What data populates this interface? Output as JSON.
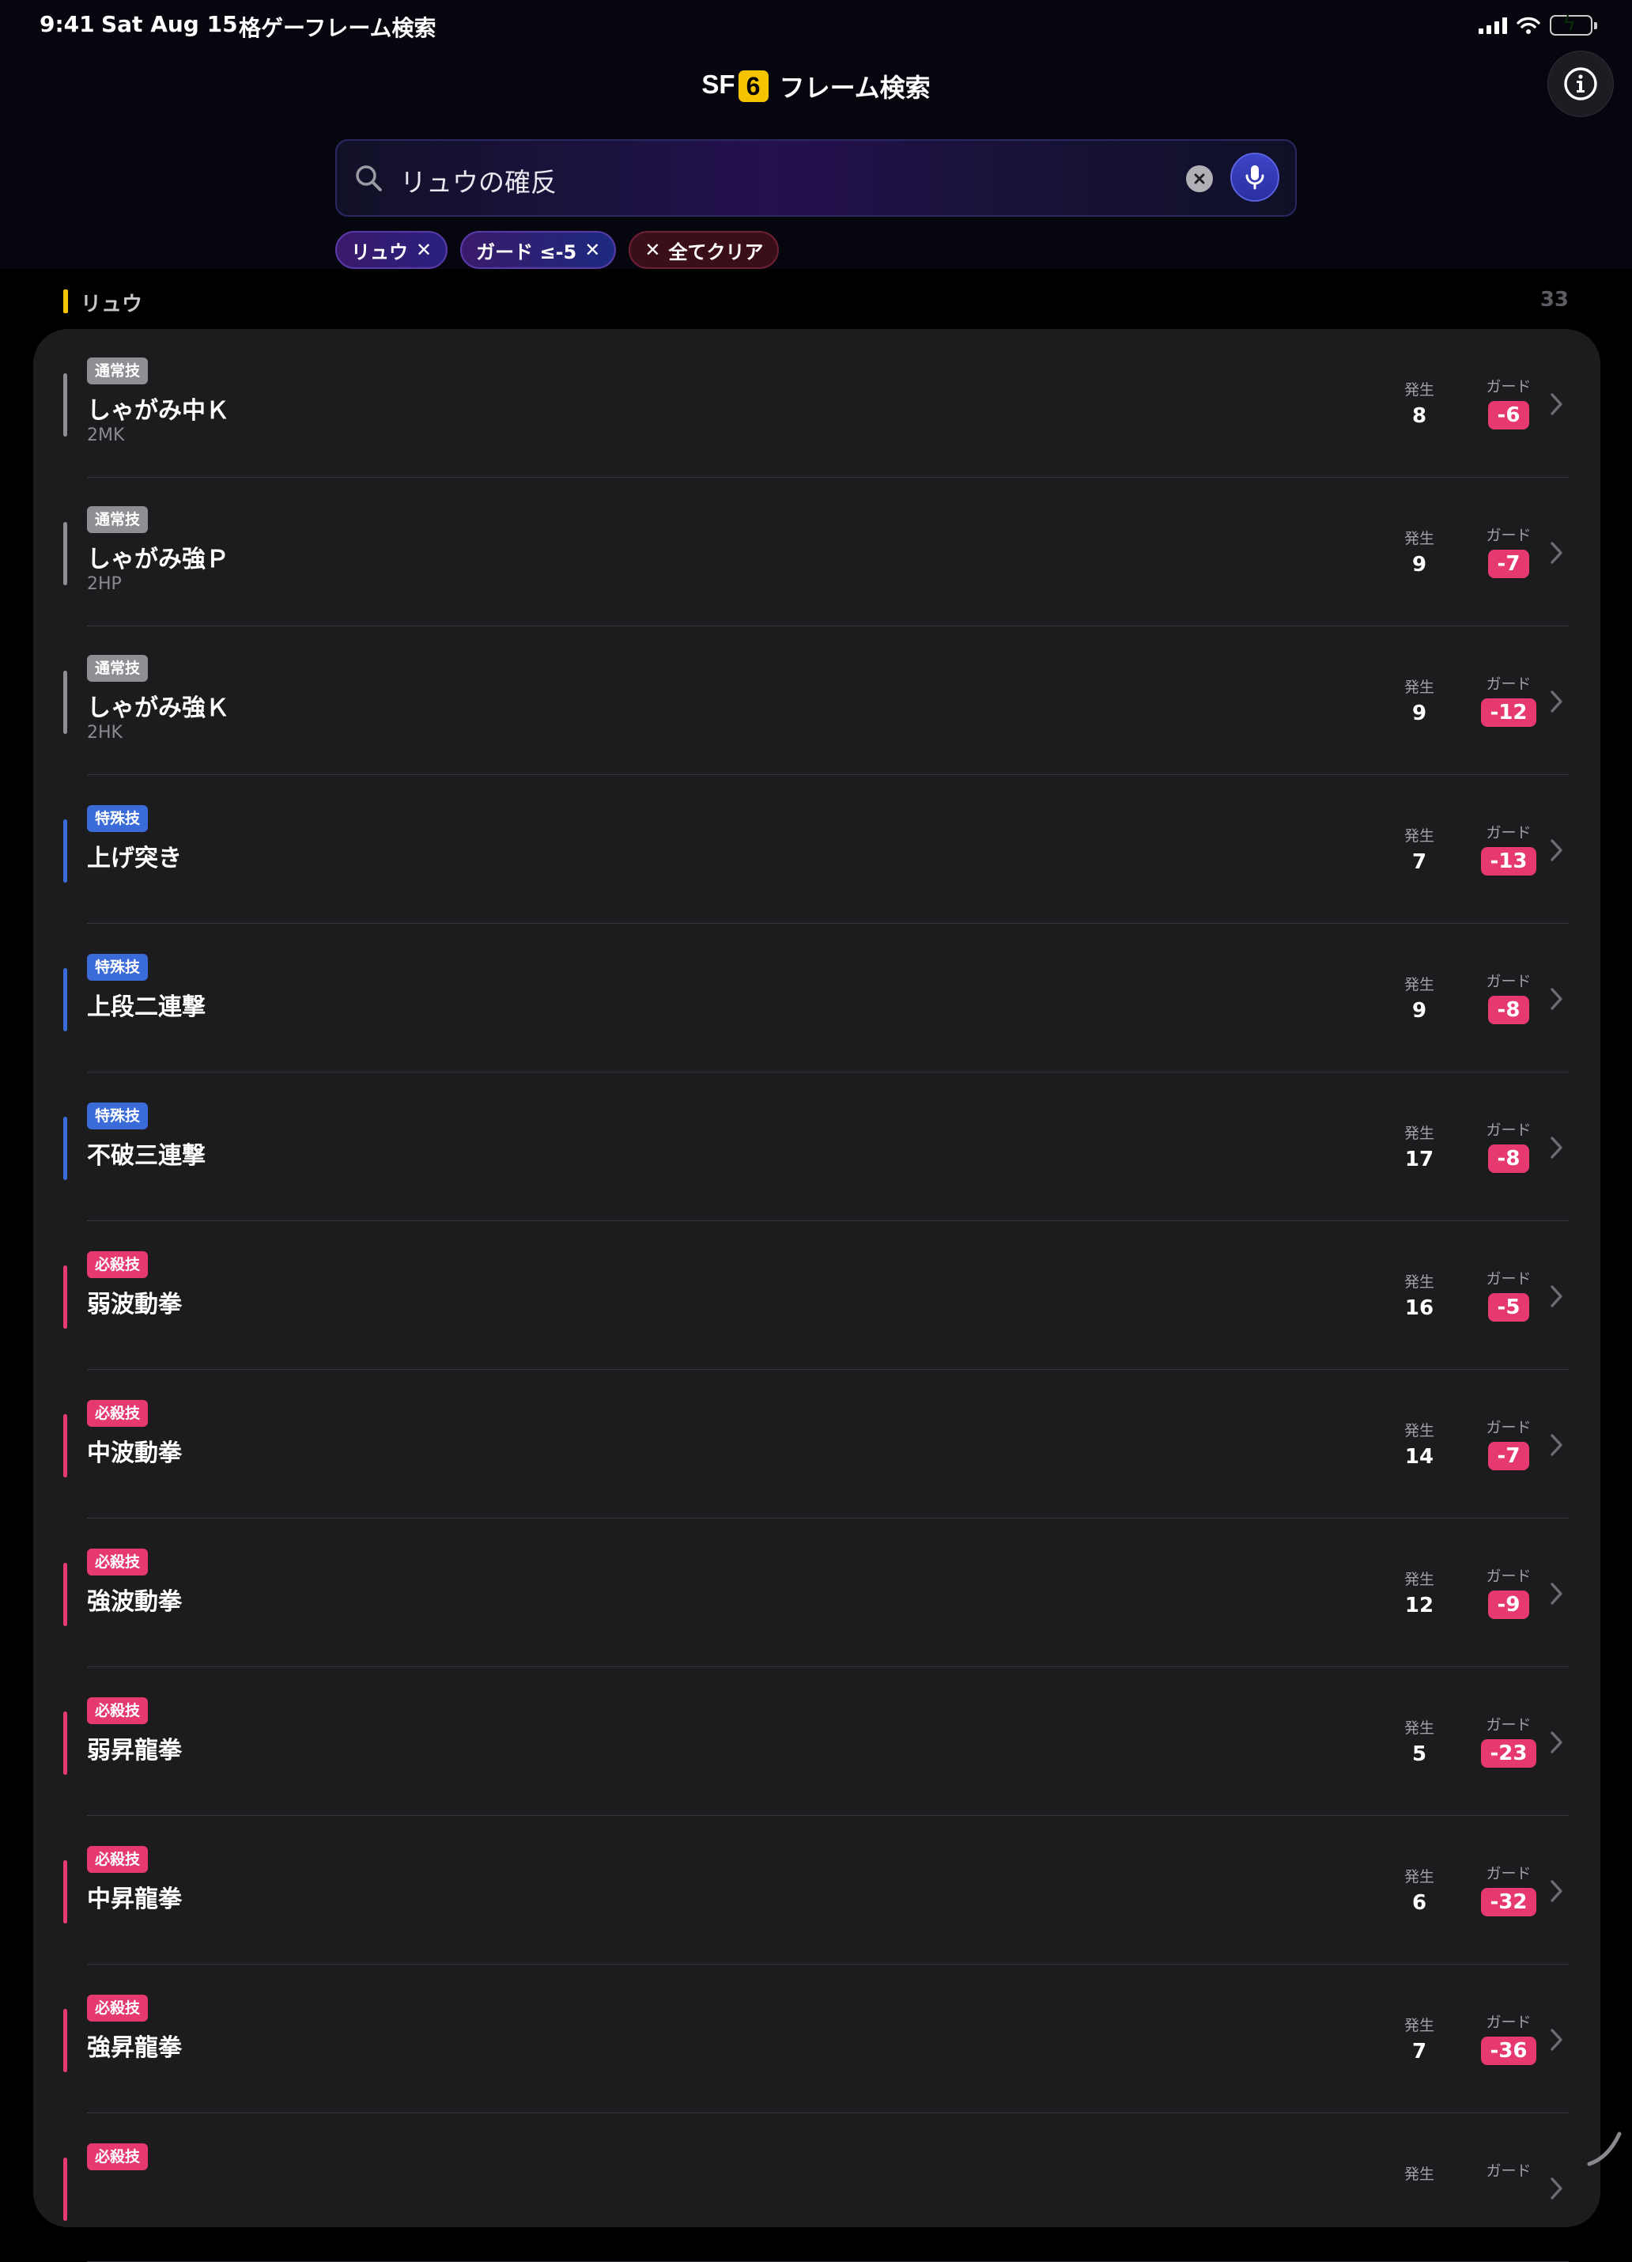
{
  "status_bar": {
    "time": "9:41",
    "date": "Sat Aug 15",
    "app_name": "格ゲーフレーム検索"
  },
  "header": {
    "title_sf": "SF",
    "title_6": "6",
    "title_rest": "フレーム検索"
  },
  "search": {
    "query": "リュウの確反"
  },
  "chips": [
    {
      "label": "リュウ"
    },
    {
      "label": "ガード ≤-5"
    },
    {
      "label": "全てクリア"
    }
  ],
  "section": {
    "name": "リュウ",
    "count": "33"
  },
  "columns": {
    "startup": "発生",
    "guard": "ガード"
  },
  "colors": {
    "normal": "#8e8e93",
    "unique": "#3a6bd8",
    "special": "#e53970",
    "accent": "#f5c400"
  },
  "moves": [
    {
      "category": "通常技",
      "type": "normal",
      "name": "しゃがみ中Ｋ",
      "notation": "2MK",
      "startup": "8",
      "guard": "-6"
    },
    {
      "category": "通常技",
      "type": "normal",
      "name": "しゃがみ強Ｐ",
      "notation": "2HP",
      "startup": "9",
      "guard": "-7"
    },
    {
      "category": "通常技",
      "type": "normal",
      "name": "しゃがみ強Ｋ",
      "notation": "2HK",
      "startup": "9",
      "guard": "-12"
    },
    {
      "category": "特殊技",
      "type": "unique",
      "name": "上げ突き",
      "notation": "",
      "startup": "7",
      "guard": "-13"
    },
    {
      "category": "特殊技",
      "type": "unique",
      "name": "上段二連撃",
      "notation": "",
      "startup": "9",
      "guard": "-8"
    },
    {
      "category": "特殊技",
      "type": "unique",
      "name": "不破三連撃",
      "notation": "",
      "startup": "17",
      "guard": "-8"
    },
    {
      "category": "必殺技",
      "type": "special",
      "name": "弱波動拳",
      "notation": "",
      "startup": "16",
      "guard": "-5"
    },
    {
      "category": "必殺技",
      "type": "special",
      "name": "中波動拳",
      "notation": "",
      "startup": "14",
      "guard": "-7"
    },
    {
      "category": "必殺技",
      "type": "special",
      "name": "強波動拳",
      "notation": "",
      "startup": "12",
      "guard": "-9"
    },
    {
      "category": "必殺技",
      "type": "special",
      "name": "弱昇龍拳",
      "notation": "",
      "startup": "5",
      "guard": "-23"
    },
    {
      "category": "必殺技",
      "type": "special",
      "name": "中昇龍拳",
      "notation": "",
      "startup": "6",
      "guard": "-32"
    },
    {
      "category": "必殺技",
      "type": "special",
      "name": "強昇龍拳",
      "notation": "",
      "startup": "7",
      "guard": "-36"
    },
    {
      "category": "必殺技",
      "type": "special",
      "name": "",
      "notation": "",
      "startup": "",
      "guard": ""
    }
  ]
}
